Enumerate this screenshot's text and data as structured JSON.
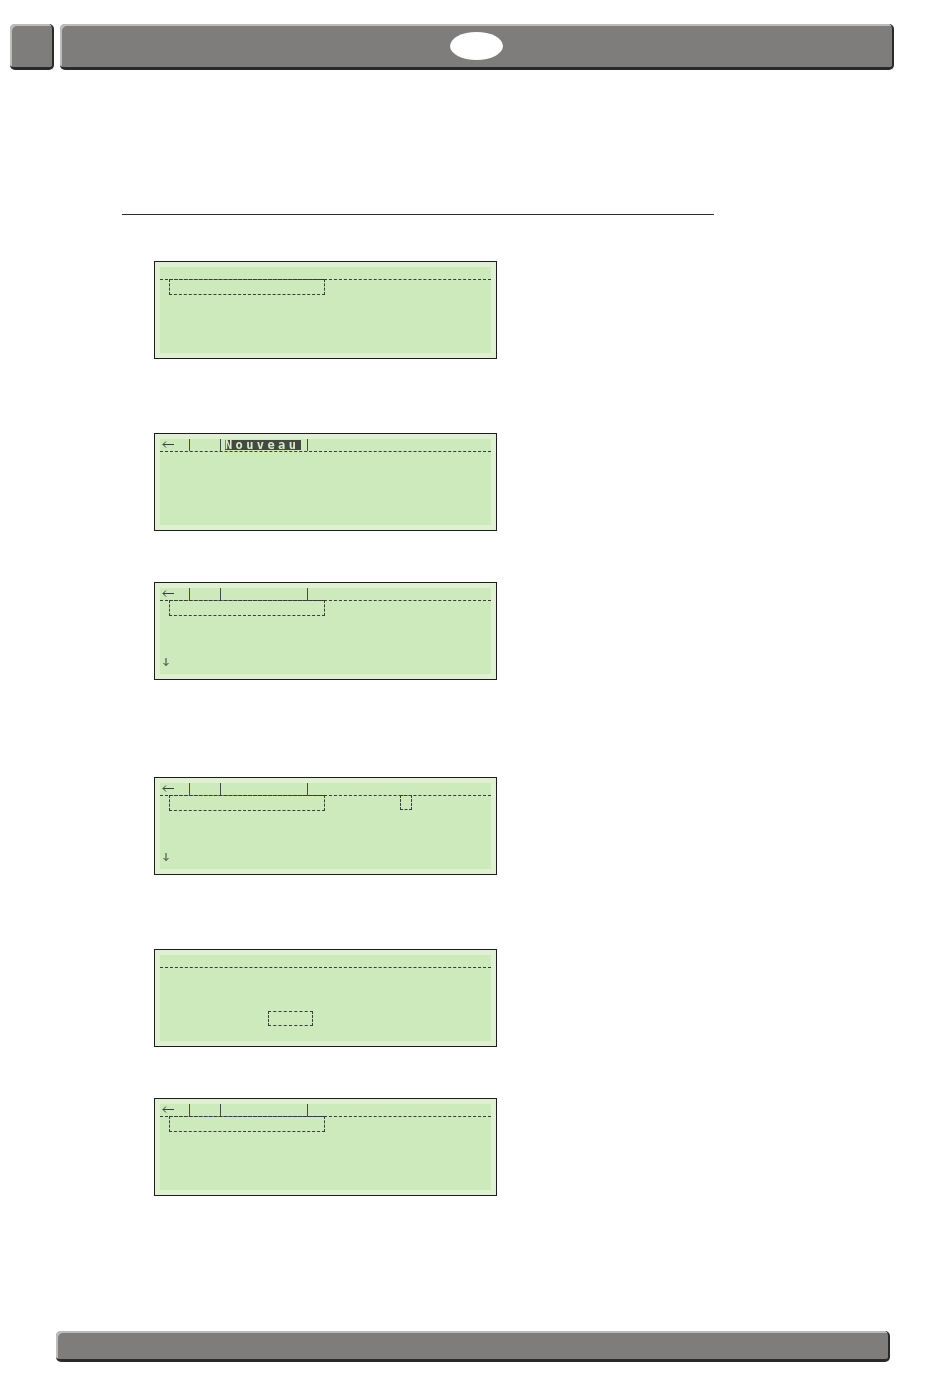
{
  "screens": [
    {
      "fields": [
        {
          "kind": "row"
        }
      ]
    },
    {
      "back_arrow": true,
      "tabs": [
        {
          "selected": false
        },
        {
          "label": "Nouveau",
          "selected": true
        }
      ]
    },
    {
      "back_arrow": true,
      "tabs": [
        {
          "selected": false
        },
        {
          "selected": false
        }
      ],
      "fields": [
        {
          "kind": "row"
        }
      ],
      "scroll_down": true
    },
    {
      "back_arrow": true,
      "tabs": [
        {
          "selected": false
        },
        {
          "selected": false
        }
      ],
      "fields": [
        {
          "kind": "row"
        },
        {
          "kind": "cursor"
        }
      ],
      "scroll_down": true
    },
    {
      "fields": [
        {
          "kind": "button"
        }
      ]
    },
    {
      "back_arrow": true,
      "tabs": [
        {
          "selected": false
        },
        {
          "selected": false
        }
      ],
      "fields": [
        {
          "kind": "row"
        }
      ]
    }
  ]
}
